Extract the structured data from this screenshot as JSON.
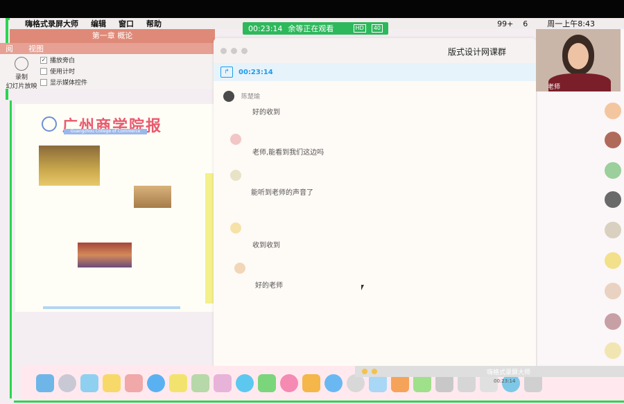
{
  "menubar": {
    "app_name": "嗨格式录屏大师",
    "items": [
      "编辑",
      "窗口",
      "帮助"
    ],
    "status": {
      "badge_99": "99+",
      "count": "6",
      "clock": "周一上午8:43"
    }
  },
  "live_bar": {
    "time": "00:23:14",
    "watching": "余等正在观看",
    "hd": "HD",
    "count": "40"
  },
  "ppt": {
    "doc_title": "第一章 概论",
    "tabs": [
      "阅",
      "视图"
    ],
    "record_label": "录制",
    "slideshow_label": "幻灯片放映",
    "checks": [
      {
        "label": "播放旁白",
        "checked": true
      },
      {
        "label": "使用计时",
        "checked": false
      },
      {
        "label": "显示媒体控件",
        "checked": false
      }
    ]
  },
  "slide": {
    "title": "广州商学院报",
    "subtitle": "Guangzhou College of Commerce"
  },
  "chat": {
    "title": "版式设计网课群",
    "share_time": "00:23:14",
    "messages": [
      {
        "name": "陈楚瑜",
        "text": "好的收到"
      },
      {
        "name": "",
        "text": "老师,能看到我们这边吗"
      },
      {
        "name": "",
        "text": "能听到老师的声音了"
      },
      {
        "name": "",
        "text": "收到收到"
      },
      {
        "name": "",
        "text": "好的老师"
      }
    ]
  },
  "video": {
    "label": "老师"
  },
  "bottom_bar": {
    "title": "嗨格式录屏大师",
    "time": "00:23:14"
  },
  "colors": {
    "accent_green": "#2eb85c",
    "ppt_accent": "#df8a78",
    "chat_blue": "#1e9be8"
  },
  "icons": {
    "share": "screen-share-icon",
    "video": "teacher-video"
  }
}
